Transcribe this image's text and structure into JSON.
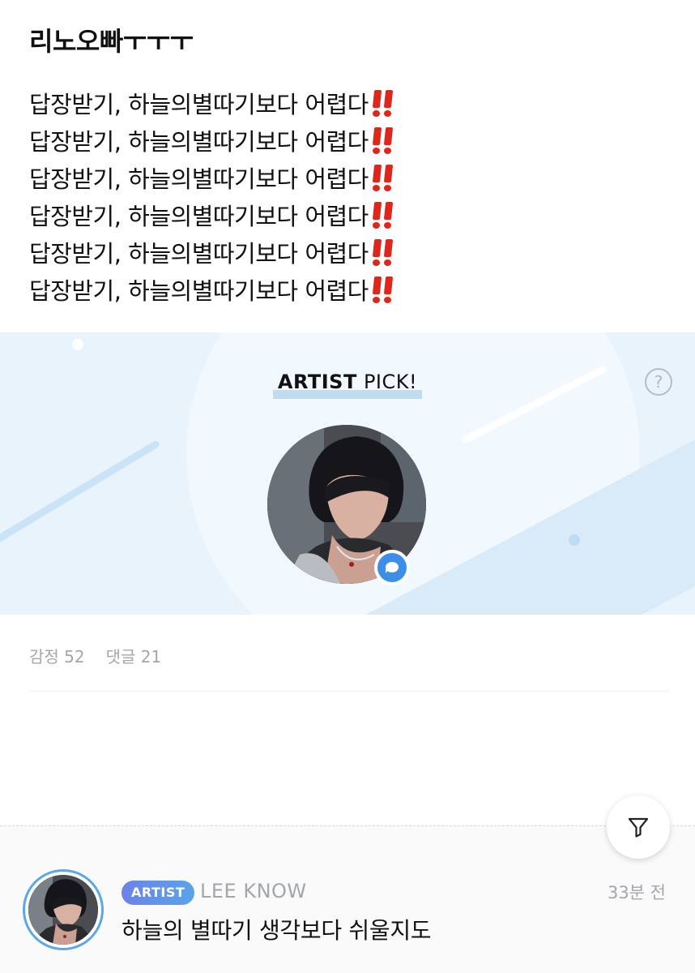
{
  "post": {
    "title": "리노오빠ㅜㅜㅜ",
    "lines": [
      "답장받기, 하늘의별따기보다 어렵다",
      "답장받기, 하늘의별따기보다 어렵다",
      "답장받기, 하늘의별따기보다 어렵다",
      "답장받기, 하늘의별따기보다 어렵다",
      "답장받기, 하늘의별따기보다 어렵다",
      "답장받기, 하늘의별따기보다 어렵다"
    ],
    "emoji_icon": "double-exclamation-icon",
    "emoji_color": "#e0251b"
  },
  "artist_pick": {
    "label_bold": "ARTIST",
    "label_rest": " PICK!",
    "help_symbol": "?",
    "background_color": "#e8f3fc",
    "badge_icon": "chat-bubble-icon",
    "badge_color": "#3d8ee6"
  },
  "stats": {
    "reactions": "감정 52",
    "comments": "댓글 21"
  },
  "filter": {
    "icon": "filter-icon"
  },
  "comment": {
    "badge": "ARTIST",
    "author": "LEE KNOW",
    "time": "33분 전",
    "text": "하늘의 별따기 생각보다 쉬울지도",
    "ring_color": "#5ca7ea"
  }
}
